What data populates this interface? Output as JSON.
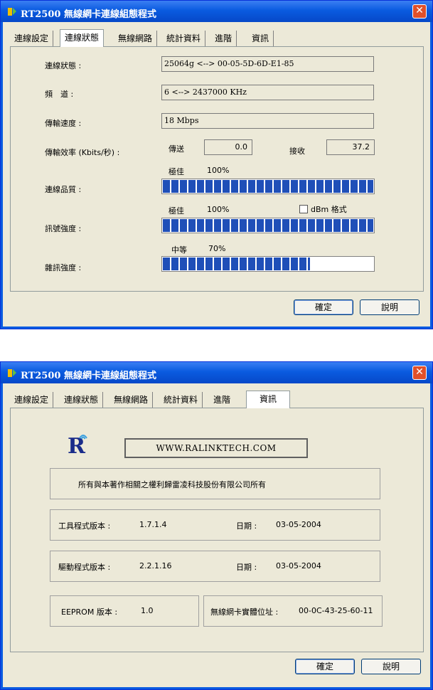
{
  "window": {
    "title": "RT2500 無線網卡連線組態程式"
  },
  "tabs": [
    "連線設定",
    "連線狀態",
    "無線網路",
    "統計資料",
    "進階",
    "資訊"
  ],
  "status": {
    "link_status_label": "連線狀態 :",
    "link_status_value": "25064g <--> 00-05-5D-6D-E1-85",
    "channel_label": "頻　道 :",
    "channel_value": "6 <--> 2437000 KHz",
    "speed_label": "傳輸速度 :",
    "speed_value": "18 Mbps",
    "throughput_label": "傳輸效率 (Kbits/秒) :",
    "tx_label": "傳送",
    "tx_value": "0.0",
    "rx_label": "接收",
    "rx_value": "37.2",
    "link_quality_label": "連線品質 :",
    "link_quality_rating": "極佳",
    "link_quality_percent": "100%",
    "link_quality_fill": 100,
    "signal_label": "訊號強度 :",
    "signal_rating": "極佳",
    "signal_percent": "100%",
    "signal_fill": 100,
    "dbm_label": "dBm 格式",
    "noise_label": "雜訊強度 :",
    "noise_rating": "中等",
    "noise_percent": "70%",
    "noise_fill": 70
  },
  "info": {
    "url": "WWW.RALINKTECH.COM",
    "copyright": "所有與本著作相關之權利歸雷凌科技股份有限公司所有",
    "utility_version_label": "工具程式版本 :",
    "utility_version": "1.7.1.4",
    "utility_date_label": "日期 :",
    "utility_date": "03-05-2004",
    "driver_version_label": "驅動程式版本 :",
    "driver_version": "2.2.1.16",
    "driver_date_label": "日期 :",
    "driver_date": "03-05-2004",
    "eeprom_label": "EEPROM 版本 :",
    "eeprom_version": "1.0",
    "mac_label": "無線網卡實體位址 :",
    "mac_value": "00-0C-43-25-60-11",
    "logo": "R"
  },
  "buttons": {
    "ok": "確定",
    "help": "說明"
  },
  "colors": {
    "titlebar": "#0a5be0",
    "bar_fill": "#1f4fb8",
    "close": "#e0502a"
  }
}
